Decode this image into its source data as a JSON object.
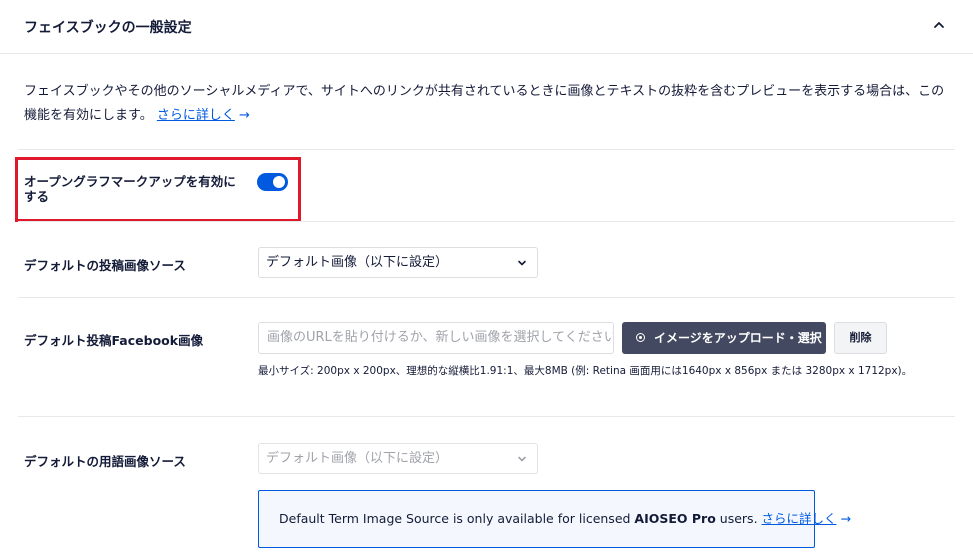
{
  "header": {
    "title": "フェイスブックの一般設定",
    "collapse_icon": "chevron-up-icon"
  },
  "description": {
    "text": "フェイスブックやその他のソーシャルメディアで、サイトへのリンクが共有されているときに画像とテキストの抜粋を含むプレビューを表示する場合は、この機能を有効にします。",
    "link": "さらに詳しく",
    "arrow": "→"
  },
  "og_markup": {
    "label": "オープングラフマークアップを有効にする",
    "enabled": true,
    "highlight_color": "#e0182c"
  },
  "default_post_image_source": {
    "label": "デフォルトの投稿画像ソース",
    "selected": "デフォルト画像（以下に設定）"
  },
  "default_facebook_image": {
    "label": "デフォルト投稿Facebook画像",
    "placeholder": "画像のURLを貼り付けるか、新しい画像を選択してください",
    "upload_label": "イメージをアップロード・選択",
    "delete_label": "削除",
    "size_note": "最小サイズ: 200px x 200px、理想的な縦横比1.91:1、最大8MB (例: Retina 画面用には1640px x 856px または 3280px x 1712px)。"
  },
  "default_term_image_source": {
    "label": "デフォルトの用語画像ソース",
    "selected": "デフォルト画像（以下に設定）",
    "disabled": true
  },
  "notice": {
    "text_before": "Default Term Image Source is only available for licensed ",
    "product": "AIOSEO Pro",
    "text_after": " users. ",
    "link": "さらに詳しく",
    "arrow": "→"
  },
  "colors": {
    "accent": "#005ae0",
    "button_dark": "#434960",
    "text": "#141b38",
    "border": "#e8e8eb"
  }
}
